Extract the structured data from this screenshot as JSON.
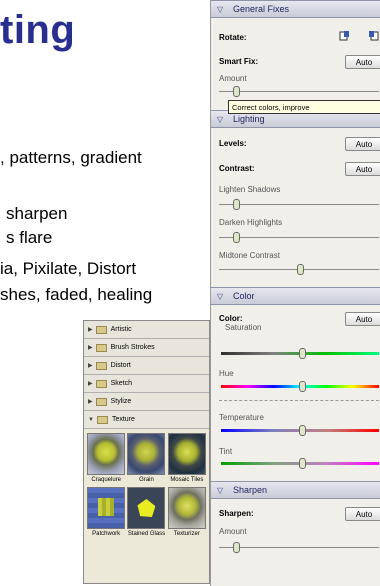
{
  "slide": {
    "title": "ting",
    "lines": [
      ", patterns, gradient",
      "sharpen",
      "s flare",
      "ia, Pixilate, Distort",
      "shes, faded, healing"
    ]
  },
  "gallery": {
    "categories": [
      "Artistic",
      "Brush Strokes",
      "Distort",
      "Sketch",
      "Stylize",
      "Texture"
    ],
    "thumbs": [
      "Craquelure",
      "Grain",
      "Mosaic Tiles",
      "Patchwork",
      "Stained Glass",
      "Texturizer"
    ]
  },
  "panel": {
    "general": {
      "header": "General Fixes",
      "rotate": "Rotate:",
      "smart_fix": "Smart Fix:",
      "auto": "Auto",
      "amount": "Amount",
      "tooltip": "Correct colors, improve"
    },
    "lighting": {
      "header": "Lighting",
      "levels": "Levels:",
      "contrast": "Contrast:",
      "auto": "Auto",
      "lighten": "Lighten Shadows",
      "darken": "Darken Highlights",
      "midtone": "Midtone Contrast"
    },
    "color": {
      "header": "Color",
      "color_label": "Color:",
      "auto": "Auto",
      "saturation": "Saturation",
      "hue": "Hue",
      "temperature": "Temperature",
      "tint": "Tint"
    },
    "sharpen": {
      "header": "Sharpen",
      "sharpen_label": "Sharpen:",
      "auto": "Auto",
      "amount": "Amount"
    }
  },
  "colors": {
    "title": "#2a2f8f",
    "panel_header": "#c9cbd8"
  },
  "icons": [
    "chevron-down-icon",
    "rotate-left-icon",
    "rotate-right-icon",
    "folder-icon",
    "expand-triangle-icon"
  ]
}
